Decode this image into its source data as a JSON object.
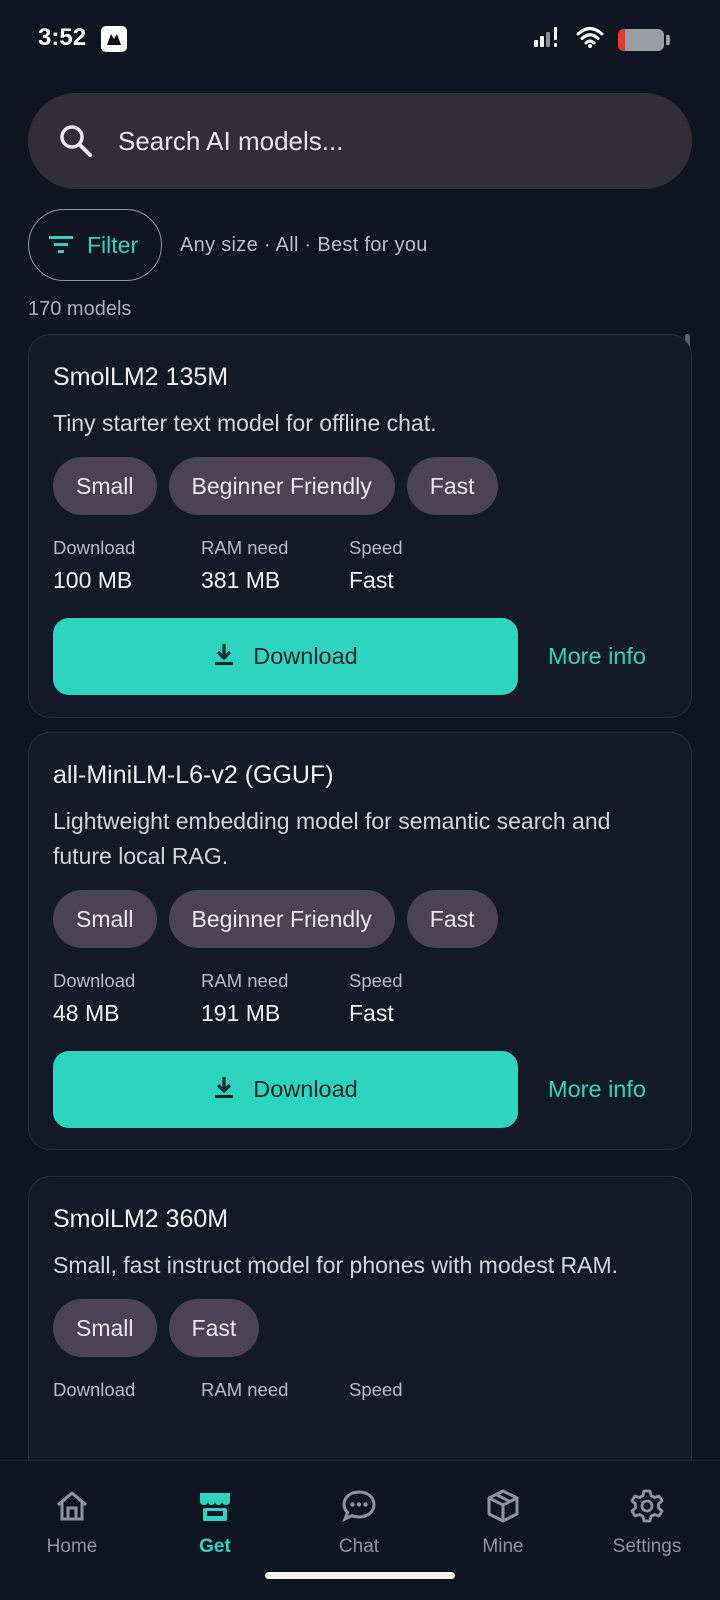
{
  "status_bar": {
    "time": "3:52"
  },
  "search": {
    "placeholder": "Search AI models..."
  },
  "filter": {
    "label": "Filter",
    "summary": "Any size · All · Best for you"
  },
  "results_count": "170 models",
  "stat_labels": {
    "download": "Download",
    "ram": "RAM need",
    "speed": "Speed"
  },
  "actions": {
    "download_label": "Download",
    "more_info_label": "More info"
  },
  "models": [
    {
      "name": "SmolLM2 135M",
      "description": "Tiny starter text model for offline chat.",
      "tags": [
        "Small",
        "Beginner Friendly",
        "Fast"
      ],
      "download": "100 MB",
      "ram": "381 MB",
      "speed": "Fast"
    },
    {
      "name": "all-MiniLM-L6-v2 (GGUF)",
      "description": "Lightweight embedding model for semantic search and future local RAG.",
      "tags": [
        "Small",
        "Beginner Friendly",
        "Fast"
      ],
      "download": "48 MB",
      "ram": "191 MB",
      "speed": "Fast"
    },
    {
      "name": "SmolLM2 360M",
      "description": "Small, fast instruct model for phones with modest RAM.",
      "tags": [
        "Small",
        "Fast"
      ]
    }
  ],
  "nav": [
    {
      "label": "Home",
      "icon": "home-icon"
    },
    {
      "label": "Get",
      "icon": "store-icon",
      "active": true
    },
    {
      "label": "Chat",
      "icon": "chat-icon"
    },
    {
      "label": "Mine",
      "icon": "box-icon"
    },
    {
      "label": "Settings",
      "icon": "gear-icon"
    }
  ],
  "colors": {
    "accent": "#2dd4bf",
    "background": "#0f1520",
    "card": "#121a26",
    "chip": "#4b4354"
  }
}
